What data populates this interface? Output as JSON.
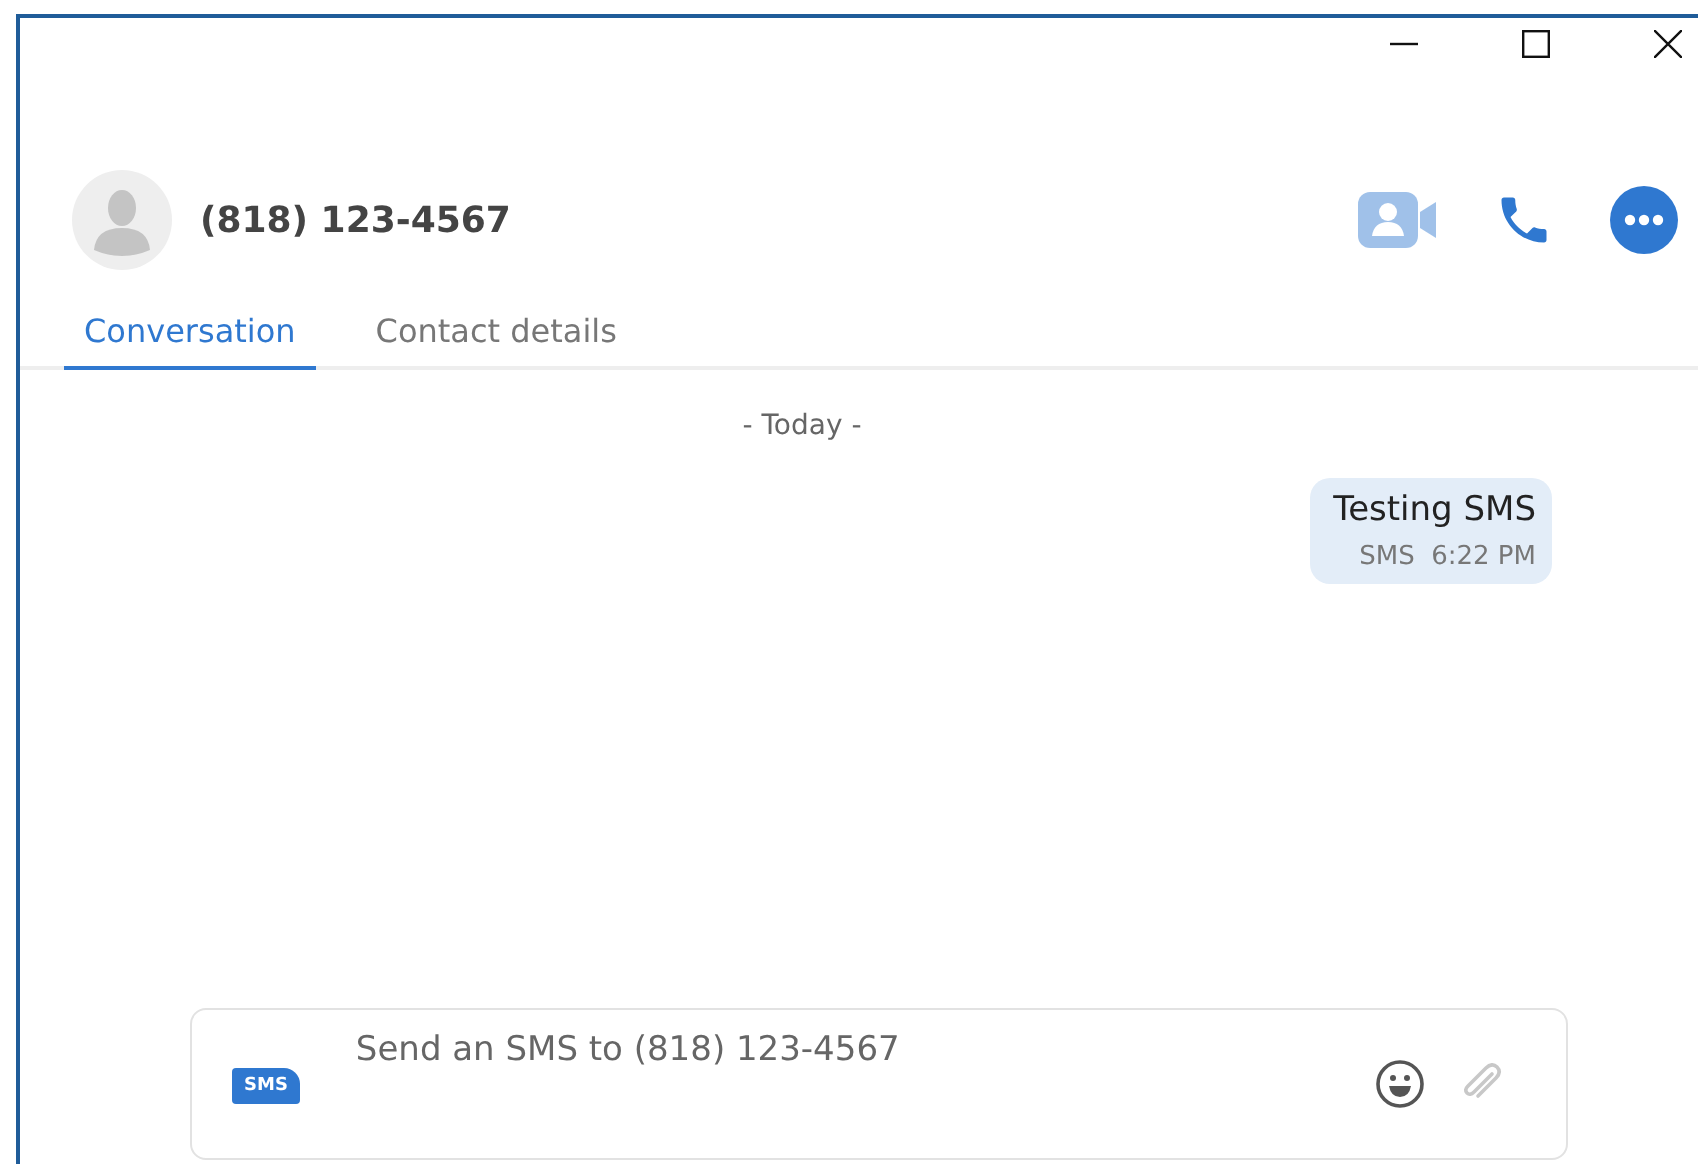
{
  "contact": {
    "name": "(818) 123-4567"
  },
  "header_actions": [
    {
      "kind": "video",
      "disabled": true
    },
    {
      "kind": "phone",
      "disabled": false
    },
    {
      "kind": "more",
      "disabled": false
    }
  ],
  "tabs": [
    {
      "label": "Conversation",
      "selected": true
    },
    {
      "label": "Contact details",
      "selected": false
    }
  ],
  "date_divider": "- Today -",
  "messages": [
    {
      "text": "Testing SMS",
      "channel": "SMS",
      "time": "6:22 PM"
    }
  ],
  "composer": {
    "badge": "SMS",
    "placeholder": "Send an SMS to (818) 123-4567",
    "attach_disabled": true
  }
}
